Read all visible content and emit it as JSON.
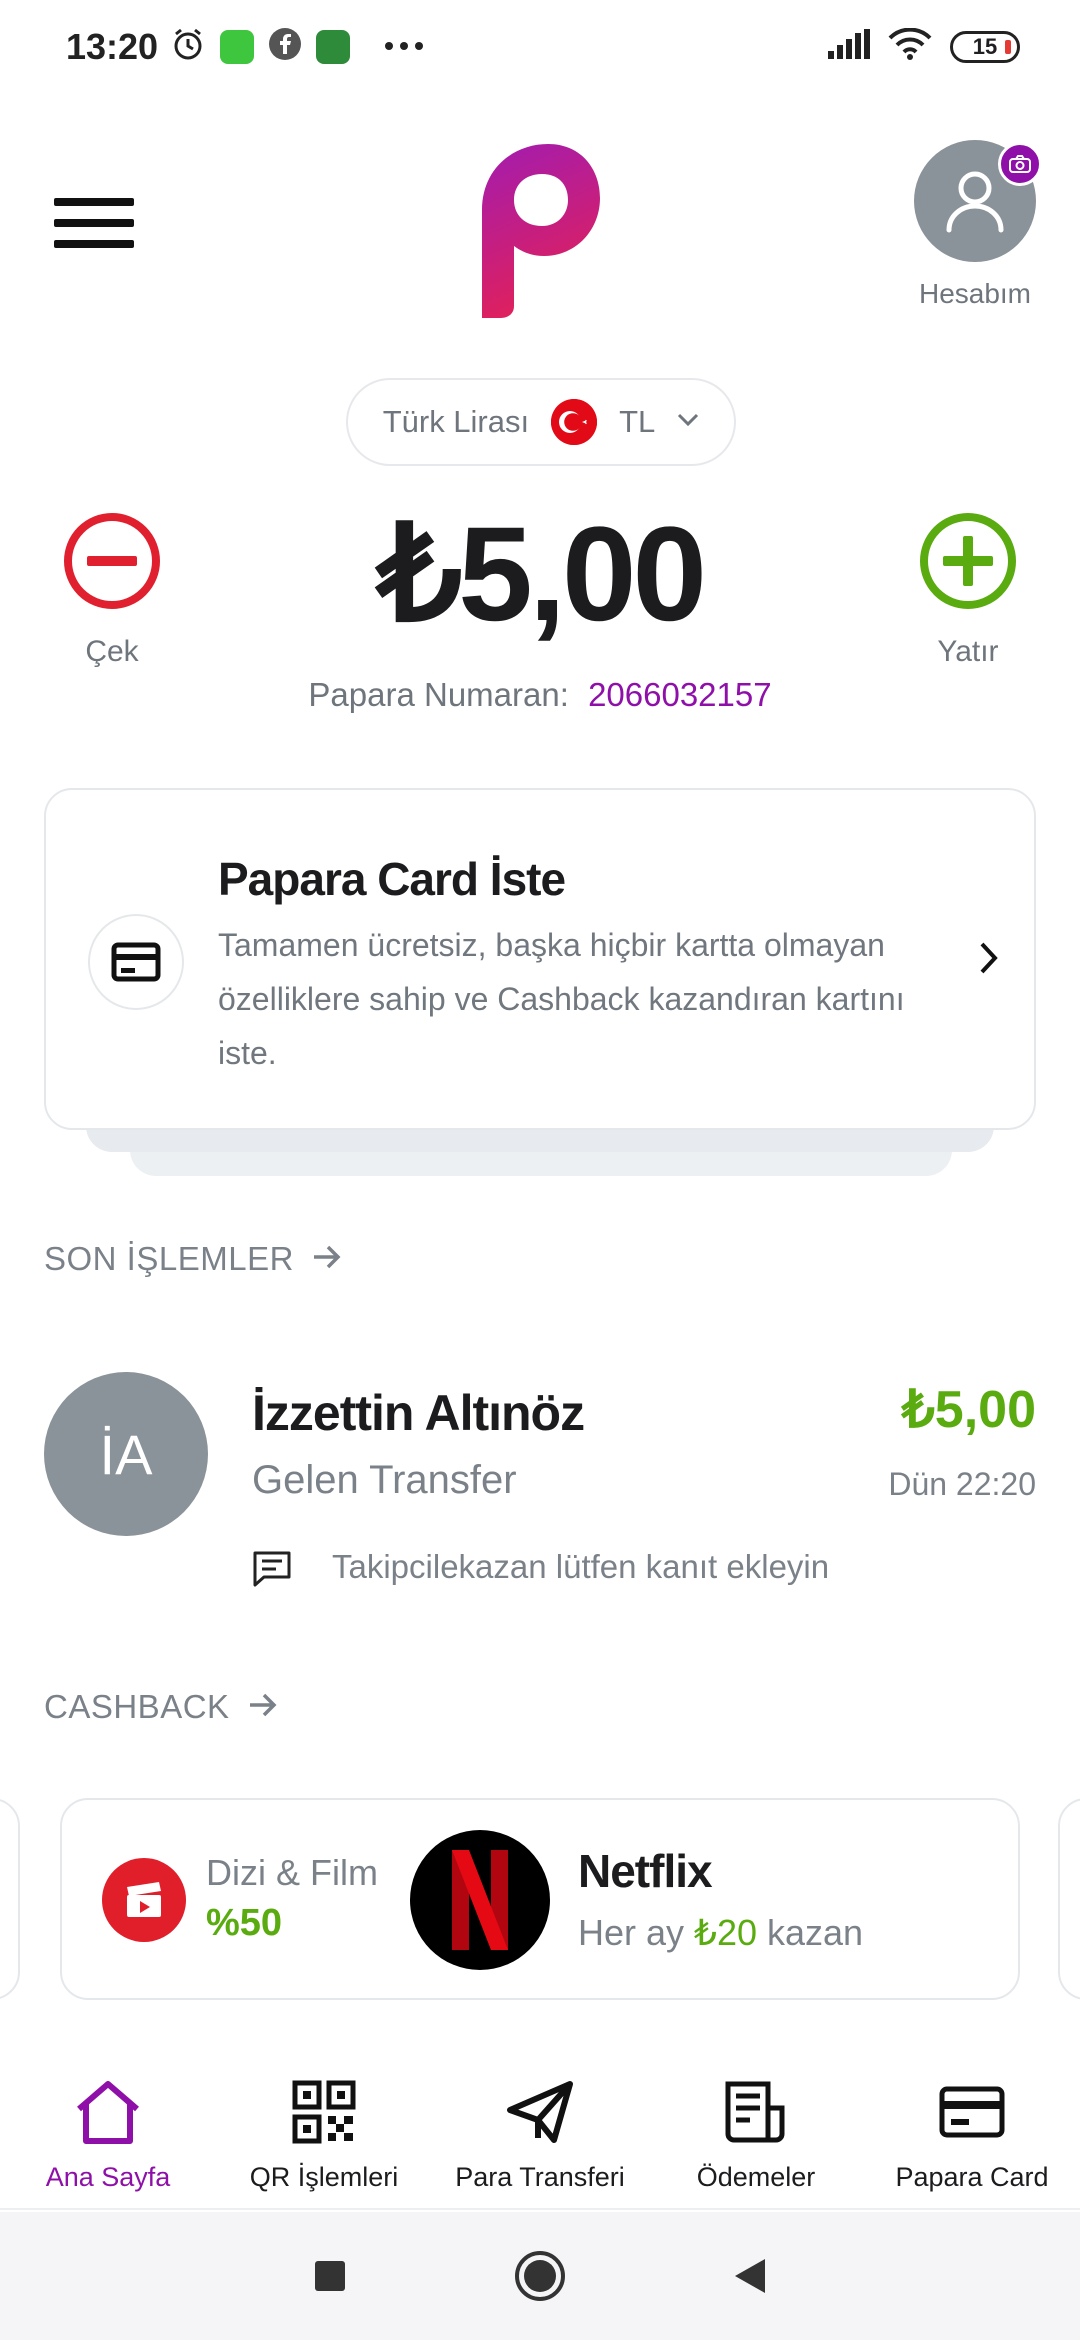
{
  "status_bar": {
    "time": "13:20",
    "battery": "15",
    "icons_left": [
      "alarm-icon",
      "app-icon-green",
      "facebook-icon",
      "app-icon-green-2",
      "more-icon"
    ],
    "icons_right": [
      "signal-icon",
      "wifi-icon",
      "battery-icon"
    ]
  },
  "header": {
    "account_label": "Hesabım"
  },
  "currency": {
    "name": "Türk Lirası",
    "code": "TL"
  },
  "balance": {
    "amount": "₺5,00",
    "withdraw_label": "Çek",
    "deposit_label": "Yatır",
    "number_label": "Papara Numaran:",
    "number_value": "2066032157"
  },
  "promo": {
    "title": "Papara Card İste",
    "description": "Tamamen ücretsiz, başka hiçbir kartta olmayan özelliklere sahip ve Cashback kazandıran kartını iste."
  },
  "recent": {
    "section_title": "SON İŞLEMLER",
    "transaction": {
      "initials": "İA",
      "name": "İzzettin Altınöz",
      "type": "Gelen Transfer",
      "amount": "₺5,00",
      "date": "Dün 22:20",
      "note": "Takipcilekazan lütfen kanıt ekleyin"
    }
  },
  "cashback": {
    "section_title": "CASHBACK",
    "category_name": "Dizi & Film",
    "category_rate": "%50",
    "brand_name": "Netflix",
    "offer_prefix": "Her ay",
    "offer_amount": "₺20",
    "offer_suffix": "kazan"
  },
  "bottom_nav": {
    "items": [
      {
        "label": "Ana Sayfa",
        "icon": "home-icon",
        "active": true
      },
      {
        "label": "QR İşlemleri",
        "icon": "qr-icon",
        "active": false
      },
      {
        "label": "Para Transferi",
        "icon": "send-icon",
        "active": false
      },
      {
        "label": "Ödemeler",
        "icon": "bill-icon",
        "active": false
      },
      {
        "label": "Papara Card",
        "icon": "card-icon",
        "active": false
      }
    ]
  },
  "colors": {
    "brand_purple": "#8e10a8",
    "positive_green": "#5aab10",
    "withdraw_red": "#e0202e"
  }
}
